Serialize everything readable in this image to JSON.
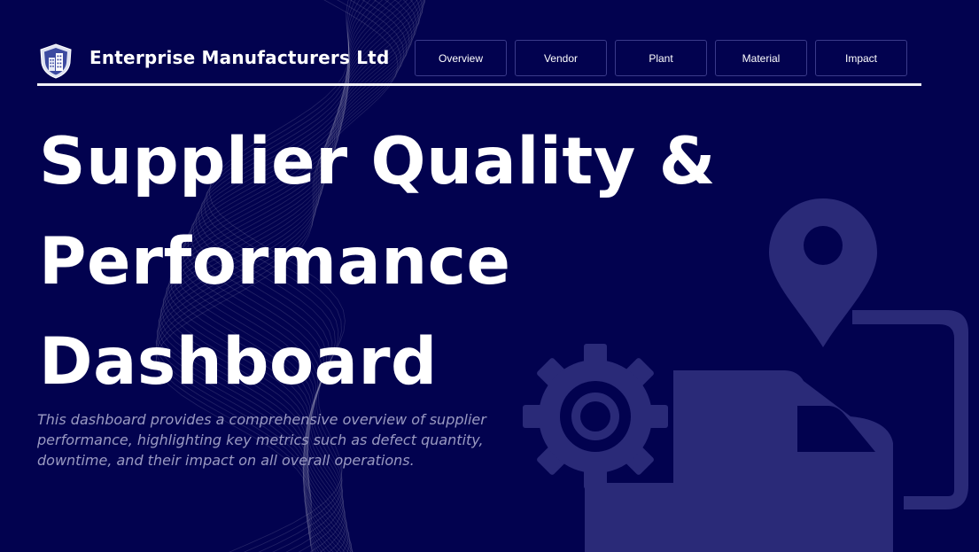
{
  "header": {
    "company_name": "Enterprise Manufacturers Ltd",
    "logo_icon": "shield-building-icon"
  },
  "nav": {
    "items": [
      {
        "label": "Overview"
      },
      {
        "label": "Vendor"
      },
      {
        "label": "Plant"
      },
      {
        "label": "Material"
      },
      {
        "label": "Impact"
      }
    ]
  },
  "hero": {
    "title_lines": [
      "Supplier Quality &",
      "Performance",
      "Dashboard"
    ],
    "description": "This dashboard provides a comprehensive overview of supplier performance, highlighting key metrics such as defect quantity, downtime, and their impact on all overall operations."
  },
  "background": {
    "illustration_icons": [
      "map-pin-icon",
      "gear-icon",
      "delivery-truck-icon"
    ]
  },
  "colors": {
    "background": "#02024f",
    "text": "#ffffff",
    "description_text": "#9a9ac2",
    "illustration": "#2a2a78"
  }
}
